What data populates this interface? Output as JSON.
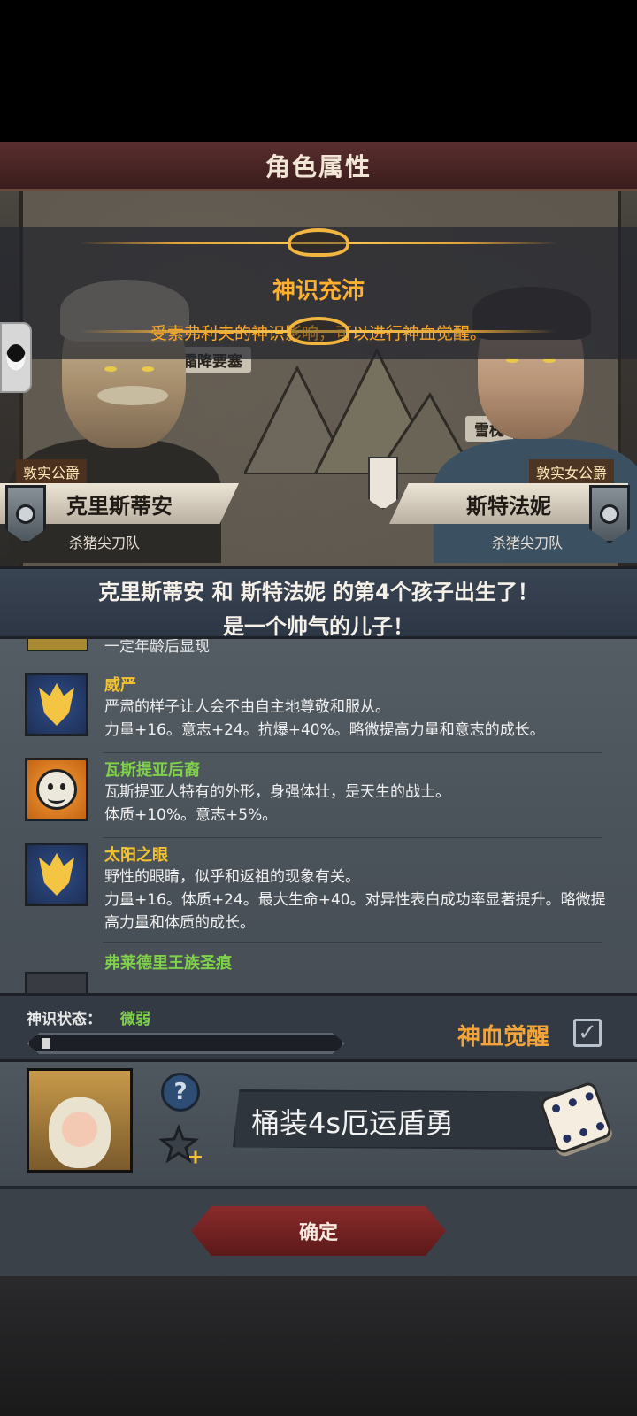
{
  "header": {
    "title": "角色属性"
  },
  "banner": {
    "title": "神识充沛",
    "description": "受索弗利夫的神识影响，可以进行神血觉醒。"
  },
  "map_labels": {
    "fortress": "霜降要塞",
    "snow": "雪槐"
  },
  "parents": {
    "father": {
      "rank": "敦实公爵",
      "name": "克里斯蒂安",
      "squad": "杀猪尖刀队"
    },
    "mother": {
      "rank": "敦实女公爵",
      "name": "斯特法妮",
      "squad": "杀猪尖刀队"
    }
  },
  "birth_announcement": {
    "line1": "克里斯蒂安 和 斯特法妮 的第4个孩子出生了！",
    "line2": "是一个帅气的儿子！"
  },
  "traits": {
    "cut_text": "一定年龄后显现",
    "items": [
      {
        "name": "威严",
        "icon": "crown-icon",
        "color": "#f2c233",
        "desc1": "严肃的样子让人会不由自主地尊敬和服从。",
        "desc2": "力量+16。意志+24。抗爆+40%。略微提高力量和意志的成长。"
      },
      {
        "name": "瓦斯提亚后裔",
        "icon": "sun-face-icon",
        "color": "#7fd04a",
        "desc1": "瓦斯提亚人特有的外形，身强体壮，是天生的战士。",
        "desc2": "体质+10%。意志+5%。"
      },
      {
        "name": "太阳之眼",
        "icon": "crown-icon",
        "color": "#f2c233",
        "desc1": "野性的眼睛，似乎和返祖的现象有关。",
        "desc2": "力量+16。体质+24。最大生命+40。对异性表白成功率显著提升。略微提高力量和体质的成长。"
      },
      {
        "name": "弗莱德里王族圣痕",
        "color": "#7fd04a"
      }
    ]
  },
  "divine_status": {
    "label": "神识状态：",
    "value": "微弱",
    "progress": 0.03,
    "awaken_label": "神血觉醒",
    "awaken_checked": true,
    "check_mark": "✓"
  },
  "child": {
    "name": "桶装4s厄运盾勇",
    "help_symbol": "?"
  },
  "footer": {
    "confirm_label": "确定"
  }
}
